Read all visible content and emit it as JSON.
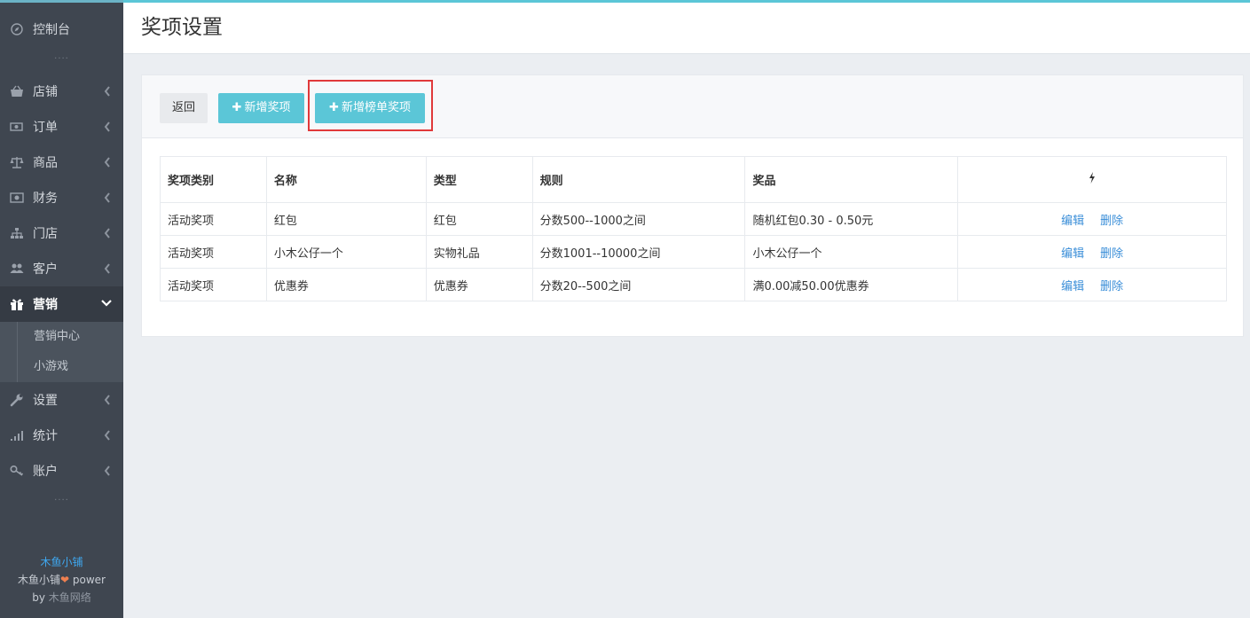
{
  "sidebar": {
    "items": [
      {
        "label": "控制台",
        "icon": "dashboard-icon"
      },
      {
        "label": "店铺",
        "icon": "basket-icon"
      },
      {
        "label": "订单",
        "icon": "order-icon"
      },
      {
        "label": "商品",
        "icon": "scale-icon"
      },
      {
        "label": "财务",
        "icon": "money-icon"
      },
      {
        "label": "门店",
        "icon": "sitemap-icon"
      },
      {
        "label": "客户",
        "icon": "users-icon"
      },
      {
        "label": "营销",
        "icon": "gift-icon",
        "active": true
      },
      {
        "label": "设置",
        "icon": "wrench-icon"
      },
      {
        "label": "统计",
        "icon": "signal-icon"
      },
      {
        "label": "账户",
        "icon": "key-icon"
      }
    ],
    "submenu": [
      "营销中心",
      "小游戏"
    ],
    "dots": "....",
    "footer": {
      "brand": "木鱼小铺",
      "line2_prefix": "木鱼小铺",
      "line2_suffix": " power",
      "line3_prefix": "by ",
      "line3_name": "木鱼网络"
    }
  },
  "header": {
    "title": "奖项设置"
  },
  "toolbar": {
    "back_label": "返回",
    "add_label": "新增奖项",
    "add_rank_label": "新增榜单奖项",
    "plus": "✚"
  },
  "table": {
    "headers": [
      "奖项类别",
      "名称",
      "类型",
      "规则",
      "奖品"
    ],
    "rows": [
      {
        "category": "活动奖项",
        "name": "红包",
        "type": "红包",
        "rule": "分数500--1000之间",
        "prize": "随机红包0.30 - 0.50元"
      },
      {
        "category": "活动奖项",
        "name": "小木公仔一个",
        "type": "实物礼品",
        "rule": "分数1001--10000之间",
        "prize": "小木公仔一个"
      },
      {
        "category": "活动奖项",
        "name": "优惠券",
        "type": "优惠券",
        "rule": "分数20--500之间",
        "prize": "满0.00减50.00优惠券"
      }
    ],
    "edit_label": "编辑",
    "delete_label": "删除"
  },
  "colors": {
    "accent": "#5bc6d7",
    "sidebar": "#3f4650",
    "highlight": "#e0393a",
    "link": "#3a8ed8"
  }
}
